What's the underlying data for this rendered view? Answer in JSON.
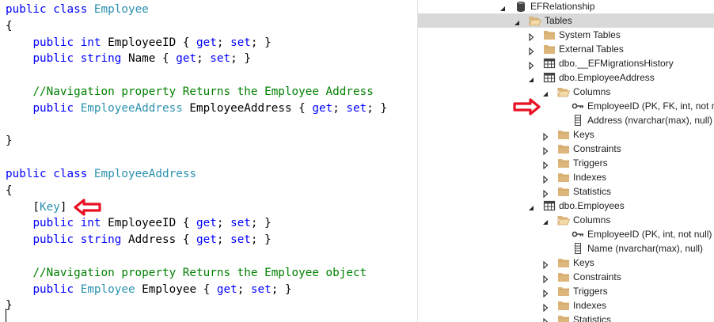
{
  "code": {
    "lines": [
      [
        [
          "kw",
          "public"
        ],
        [
          "pl",
          " "
        ],
        [
          "kw",
          "class"
        ],
        [
          "pl",
          " "
        ],
        [
          "ty",
          "Employee"
        ]
      ],
      [
        [
          "pl",
          "{"
        ]
      ],
      [
        [
          "pl",
          "    "
        ],
        [
          "kw",
          "public"
        ],
        [
          "pl",
          " "
        ],
        [
          "kw",
          "int"
        ],
        [
          "pl",
          " EmployeeID { "
        ],
        [
          "kw",
          "get"
        ],
        [
          "pl",
          "; "
        ],
        [
          "kw",
          "set"
        ],
        [
          "pl",
          "; }"
        ]
      ],
      [
        [
          "pl",
          "    "
        ],
        [
          "kw",
          "public"
        ],
        [
          "pl",
          " "
        ],
        [
          "kw",
          "string"
        ],
        [
          "pl",
          " Name { "
        ],
        [
          "kw",
          "get"
        ],
        [
          "pl",
          "; "
        ],
        [
          "kw",
          "set"
        ],
        [
          "pl",
          "; }"
        ]
      ],
      [],
      [
        [
          "pl",
          "    "
        ],
        [
          "cm",
          "//Navigation property Returns the Employee Address"
        ]
      ],
      [
        [
          "pl",
          "    "
        ],
        [
          "kw",
          "public"
        ],
        [
          "pl",
          " "
        ],
        [
          "ty",
          "EmployeeAddress"
        ],
        [
          "pl",
          " EmployeeAddress { "
        ],
        [
          "kw",
          "get"
        ],
        [
          "pl",
          "; "
        ],
        [
          "kw",
          "set"
        ],
        [
          "pl",
          "; }"
        ]
      ],
      [],
      [
        [
          "pl",
          "}"
        ]
      ],
      [],
      [
        [
          "kw",
          "public"
        ],
        [
          "pl",
          " "
        ],
        [
          "kw",
          "class"
        ],
        [
          "pl",
          " "
        ],
        [
          "ty",
          "EmployeeAddress"
        ]
      ],
      [
        [
          "pl",
          "{"
        ]
      ],
      [
        [
          "pl",
          "    ["
        ],
        [
          "ty",
          "Key"
        ],
        [
          "pl",
          "]"
        ]
      ],
      [
        [
          "pl",
          "    "
        ],
        [
          "kw",
          "public"
        ],
        [
          "pl",
          " "
        ],
        [
          "kw",
          "int"
        ],
        [
          "pl",
          " EmployeeID { "
        ],
        [
          "kw",
          "get"
        ],
        [
          "pl",
          "; "
        ],
        [
          "kw",
          "set"
        ],
        [
          "pl",
          "; }"
        ]
      ],
      [
        [
          "pl",
          "    "
        ],
        [
          "kw",
          "public"
        ],
        [
          "pl",
          " "
        ],
        [
          "kw",
          "string"
        ],
        [
          "pl",
          " Address { "
        ],
        [
          "kw",
          "get"
        ],
        [
          "pl",
          "; "
        ],
        [
          "kw",
          "set"
        ],
        [
          "pl",
          "; }"
        ]
      ],
      [],
      [
        [
          "pl",
          "    "
        ],
        [
          "cm",
          "//Navigation property Returns the Employee object"
        ]
      ],
      [
        [
          "pl",
          "    "
        ],
        [
          "kw",
          "public"
        ],
        [
          "pl",
          " "
        ],
        [
          "ty",
          "Employee"
        ],
        [
          "pl",
          " Employee { "
        ],
        [
          "kw",
          "get"
        ],
        [
          "pl",
          "; "
        ],
        [
          "kw",
          "set"
        ],
        [
          "pl",
          "; }"
        ]
      ],
      [
        [
          "pl",
          "}"
        ]
      ]
    ]
  },
  "tree": {
    "nodes": [
      {
        "level": 3,
        "expander": "expanded",
        "icon": "database-icon",
        "label": "EFRelationship"
      },
      {
        "level": 4,
        "expander": "expanded",
        "icon": "folder-open-icon",
        "label": "Tables",
        "highlight": "selected"
      },
      {
        "level": 5,
        "expander": "collapsed",
        "icon": "folder-icon",
        "label": "System Tables"
      },
      {
        "level": 5,
        "expander": "collapsed",
        "icon": "folder-icon",
        "label": "External Tables"
      },
      {
        "level": 5,
        "expander": "collapsed",
        "icon": "table-icon",
        "label": "dbo.__EFMigrationsHistory"
      },
      {
        "level": 5,
        "expander": "expanded",
        "icon": "table-icon",
        "label": "dbo.EmployeeAddress"
      },
      {
        "level": 6,
        "expander": "expanded",
        "icon": "folder-open-icon",
        "label": "Columns"
      },
      {
        "level": 7,
        "expander": "none",
        "icon": "key-icon",
        "label": "EmployeeID (PK, FK, int, not null)"
      },
      {
        "level": 7,
        "expander": "none",
        "icon": "column-icon",
        "label": "Address (nvarchar(max), null)"
      },
      {
        "level": 6,
        "expander": "collapsed",
        "icon": "folder-icon",
        "label": "Keys"
      },
      {
        "level": 6,
        "expander": "collapsed",
        "icon": "folder-icon",
        "label": "Constraints"
      },
      {
        "level": 6,
        "expander": "collapsed",
        "icon": "folder-icon",
        "label": "Triggers"
      },
      {
        "level": 6,
        "expander": "collapsed",
        "icon": "folder-icon",
        "label": "Indexes"
      },
      {
        "level": 6,
        "expander": "collapsed",
        "icon": "folder-icon",
        "label": "Statistics"
      },
      {
        "level": 5,
        "expander": "expanded",
        "icon": "table-icon",
        "label": "dbo.Employees"
      },
      {
        "level": 6,
        "expander": "expanded",
        "icon": "folder-open-icon",
        "label": "Columns"
      },
      {
        "level": 7,
        "expander": "none",
        "icon": "key-icon",
        "label": "EmployeeID (PK, int, not null)"
      },
      {
        "level": 7,
        "expander": "none",
        "icon": "column-icon",
        "label": "Name (nvarchar(max), null)"
      },
      {
        "level": 6,
        "expander": "collapsed",
        "icon": "folder-icon",
        "label": "Keys"
      },
      {
        "level": 6,
        "expander": "collapsed",
        "icon": "folder-icon",
        "label": "Constraints"
      },
      {
        "level": 6,
        "expander": "collapsed",
        "icon": "folder-icon",
        "label": "Triggers"
      },
      {
        "level": 6,
        "expander": "collapsed",
        "icon": "folder-icon",
        "label": "Indexes"
      },
      {
        "level": 6,
        "expander": "collapsed",
        "icon": "folder-icon",
        "label": "Statistics"
      }
    ]
  },
  "annotations": {
    "arrow_color": "#e81123",
    "arrows": [
      {
        "name": "key-attribute-arrow-icon",
        "direction": "left"
      },
      {
        "name": "employeeid-column-arrow-icon",
        "direction": "right"
      }
    ]
  },
  "colors": {
    "keyword": "#0000ff",
    "type": "#2b91af",
    "comment": "#008000",
    "selection": "#cce8ff",
    "folder": "#dcb67a"
  }
}
